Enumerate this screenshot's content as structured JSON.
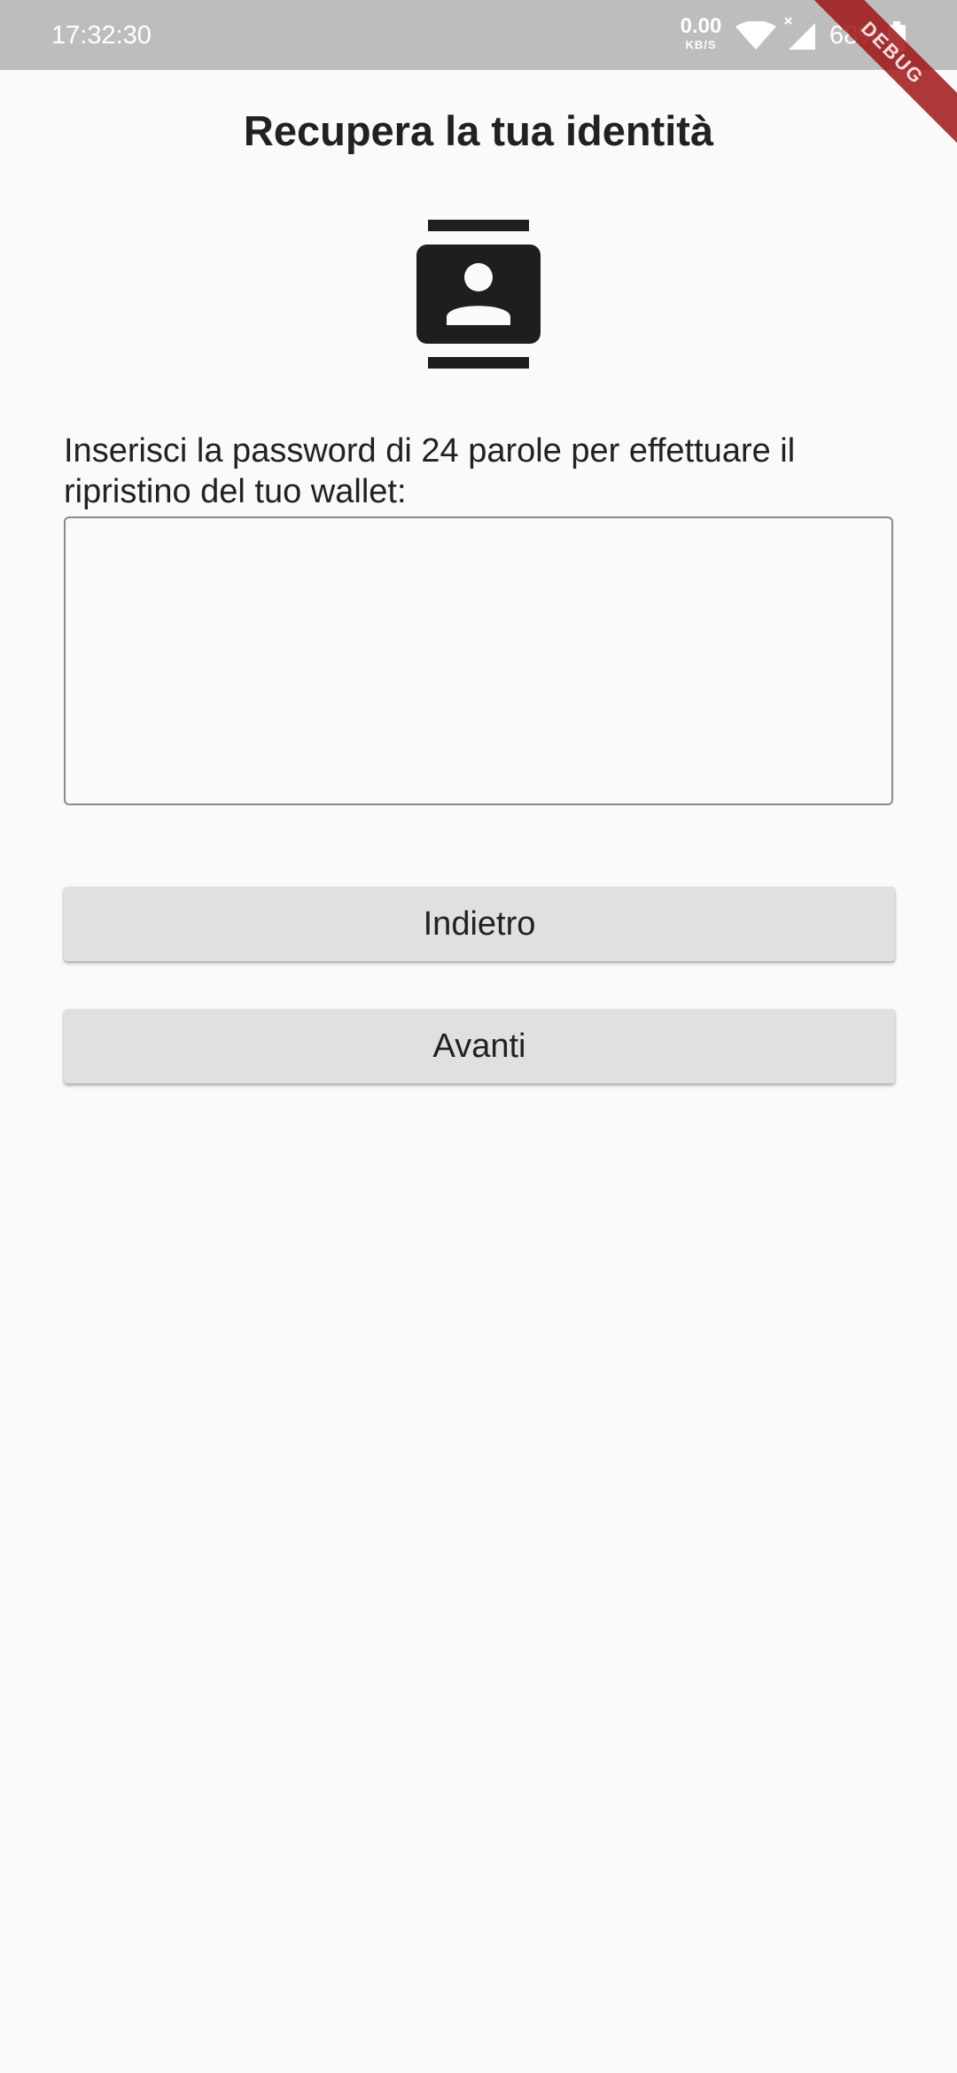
{
  "status_bar": {
    "time": "17:32:30",
    "net_speed_value": "0.00",
    "net_speed_unit": "KB/S",
    "battery_percent": "68%",
    "icons": [
      "wifi-icon",
      "signal-icon",
      "battery-icon"
    ]
  },
  "debug_banner": {
    "label": "DEBUG"
  },
  "page": {
    "title": "Recupera la tua identità",
    "icon": "contact-card-icon",
    "instruction": "Inserisci la password di 24 parole per effettuare il ripristino del tuo wallet:",
    "password_input": {
      "value": "",
      "placeholder": ""
    }
  },
  "buttons": {
    "back_label": "Indietro",
    "next_label": "Avanti"
  },
  "colors": {
    "background": "#fafafa",
    "status_bar": "#bdbdbd",
    "button": "#e0e0e0",
    "text": "#212121",
    "icon": "#1e1e1e",
    "debug_banner": "#a01414"
  }
}
